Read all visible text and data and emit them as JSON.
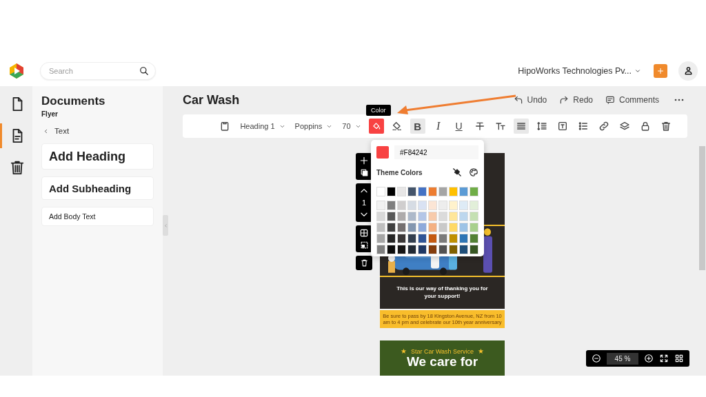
{
  "header": {
    "search": {
      "placeholder": "Search"
    },
    "company": "HipoWorks Technologies Pv..."
  },
  "rail": {
    "items": [
      {
        "selected": false
      },
      {
        "selected": true
      },
      {
        "selected": false
      }
    ]
  },
  "panel": {
    "title": "Documents",
    "subtitle": "Flyer",
    "back": "Text",
    "options": [
      {
        "kind": "heading",
        "label": "Add Heading"
      },
      {
        "kind": "subheading",
        "label": "Add Subheading"
      },
      {
        "kind": "body",
        "label": "Add Body Text"
      }
    ]
  },
  "document": {
    "title": "Car Wash",
    "actions": [
      {
        "label": "Undo"
      },
      {
        "label": "Redo"
      },
      {
        "label": "Comments"
      }
    ]
  },
  "toolbar": {
    "items": [
      {
        "kind": "icon",
        "selected": false
      },
      {
        "kind": "dropdown",
        "label": "Heading 1"
      },
      {
        "kind": "dropdown",
        "label": "Poppins"
      },
      {
        "kind": "dropdown",
        "label": "70"
      },
      {
        "kind": "color",
        "selected": true
      },
      {
        "kind": "icon",
        "selected": false
      },
      {
        "kind": "bold",
        "label": "B",
        "selected": true
      },
      {
        "kind": "italic",
        "label": "I",
        "selected": false
      },
      {
        "kind": "underline",
        "label": "U",
        "selected": false
      },
      {
        "kind": "icon",
        "selected": false
      },
      {
        "kind": "icon",
        "selected": false
      },
      {
        "kind": "icon",
        "selected": true
      },
      {
        "kind": "icon",
        "selected": false
      },
      {
        "kind": "icon",
        "selected": false
      },
      {
        "kind": "icon",
        "selected": false
      },
      {
        "kind": "icon",
        "selected": false
      },
      {
        "kind": "icon",
        "selected": false
      },
      {
        "kind": "icon",
        "selected": false
      },
      {
        "kind": "icon",
        "selected": false
      }
    ]
  },
  "tooltip": "Color",
  "color_picker": {
    "value": "#F84242",
    "color": "#f84242",
    "heading": "Theme Colors",
    "rows": [
      {
        "swatches": [
          {
            "color": "#ffffff"
          },
          {
            "color": "#000000"
          },
          {
            "color": "#e7e6e6"
          },
          {
            "color": "#44546a"
          },
          {
            "color": "#4472c4"
          },
          {
            "color": "#ed7d31"
          },
          {
            "color": "#a5a5a5"
          },
          {
            "color": "#ffc000"
          },
          {
            "color": "#5b9bd5"
          },
          {
            "color": "#70ad47"
          }
        ]
      },
      {
        "swatches": [
          {
            "color": "#f2f2f2"
          },
          {
            "color": "#7f7f7f"
          },
          {
            "color": "#d0cece"
          },
          {
            "color": "#d6dce4"
          },
          {
            "color": "#d9e2f3"
          },
          {
            "color": "#fbe5d5"
          },
          {
            "color": "#ededed"
          },
          {
            "color": "#fff2cc"
          },
          {
            "color": "#deebf6"
          },
          {
            "color": "#e2efd9"
          }
        ]
      },
      {
        "swatches": [
          {
            "color": "#d9d9d9"
          },
          {
            "color": "#595959"
          },
          {
            "color": "#aeabab"
          },
          {
            "color": "#adb9ca"
          },
          {
            "color": "#b4c6e7"
          },
          {
            "color": "#f7cbac"
          },
          {
            "color": "#dbdbdb"
          },
          {
            "color": "#ffe699"
          },
          {
            "color": "#bdd7ee"
          },
          {
            "color": "#c5e0b3"
          }
        ]
      },
      {
        "swatches": [
          {
            "color": "#bfbfbf"
          },
          {
            "color": "#404040"
          },
          {
            "color": "#757070"
          },
          {
            "color": "#8497b0"
          },
          {
            "color": "#8eaadb"
          },
          {
            "color": "#f4b183"
          },
          {
            "color": "#c9c9c9"
          },
          {
            "color": "#ffd966"
          },
          {
            "color": "#9dc3e6"
          },
          {
            "color": "#a8d08d"
          }
        ]
      },
      {
        "swatches": [
          {
            "color": "#a6a6a6"
          },
          {
            "color": "#262626"
          },
          {
            "color": "#3b3838"
          },
          {
            "color": "#333f4f"
          },
          {
            "color": "#2f5496"
          },
          {
            "color": "#c55a11"
          },
          {
            "color": "#7b7b7b"
          },
          {
            "color": "#bf9000"
          },
          {
            "color": "#2e75b5"
          },
          {
            "color": "#538135"
          }
        ]
      },
      {
        "swatches": [
          {
            "color": "#808080"
          },
          {
            "color": "#0d0d0d"
          },
          {
            "color": "#171616"
          },
          {
            "color": "#222a35"
          },
          {
            "color": "#1f3864"
          },
          {
            "color": "#843c0c"
          },
          {
            "color": "#525252"
          },
          {
            "color": "#7f6000"
          },
          {
            "color": "#1f4e79"
          },
          {
            "color": "#375623"
          }
        ]
      }
    ]
  },
  "page_controls": {
    "page": "1"
  },
  "flyer": {
    "message": "This is our way of thanking you for your support!",
    "note": "Be sure to pass by 18 Kingston Avenue, NZ from 10 am to 4 pm and celebrate our 10th year anniversary",
    "next_page": {
      "left_mark": "★",
      "tagline": "Star Car Wash Service",
      "right_mark": "★",
      "headline": "We care for"
    }
  },
  "zoom": {
    "value": "45 %"
  }
}
